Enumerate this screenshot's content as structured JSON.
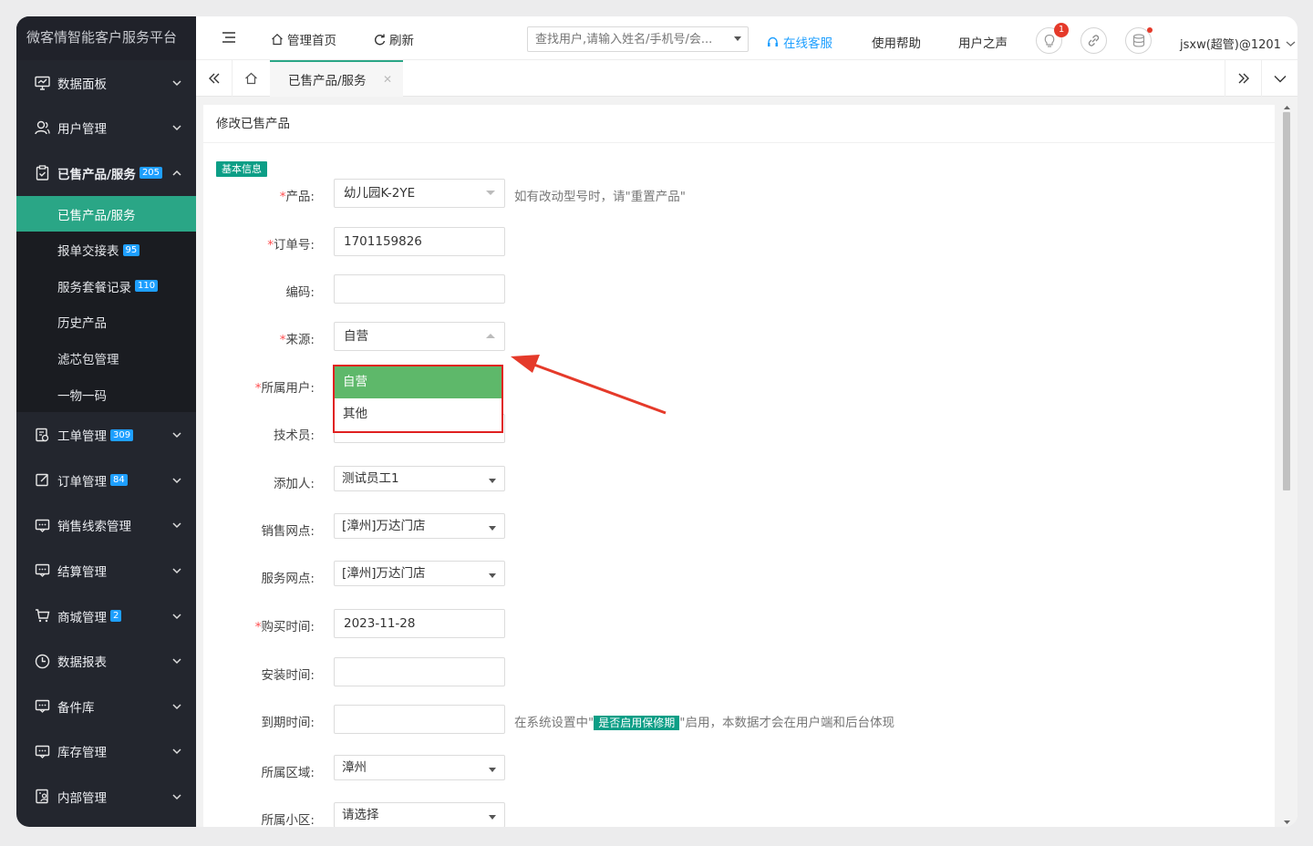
{
  "app": {
    "title": "微客情智能客户服务平台"
  },
  "sidebar": {
    "items": [
      {
        "label": "数据面板",
        "icon": "dashboard-icon"
      },
      {
        "label": "用户管理",
        "icon": "user-icon"
      },
      {
        "label": "已售产品/服务",
        "icon": "clipboard-check-icon",
        "badge": "205"
      }
    ],
    "subitems": [
      {
        "label": "已售产品/服务"
      },
      {
        "label": "报单交接表",
        "badge": "95"
      },
      {
        "label": "服务套餐记录",
        "badge": "110"
      },
      {
        "label": "历史产品"
      },
      {
        "label": "滤芯包管理"
      },
      {
        "label": "一物一码"
      }
    ],
    "items2": [
      {
        "label": "工单管理",
        "badge": "309",
        "icon": "workorder-icon"
      },
      {
        "label": "订单管理",
        "badge": "84",
        "icon": "order-edit-icon"
      },
      {
        "label": "销售线索管理",
        "icon": "chat-icon"
      },
      {
        "label": "结算管理",
        "icon": "chat-icon"
      },
      {
        "label": "商城管理",
        "badge": "2",
        "icon": "cart-icon"
      },
      {
        "label": "数据报表",
        "icon": "clock-icon"
      },
      {
        "label": "备件库",
        "icon": "chat-icon"
      },
      {
        "label": "库存管理",
        "icon": "chat-icon"
      },
      {
        "label": "内部管理",
        "icon": "internal-icon"
      }
    ]
  },
  "header": {
    "menu_icon": "menu-icon",
    "home_label": "管理首页",
    "refresh_label": "刷新",
    "search_placeholder": "查找用户,请输入姓名/手机号/会...",
    "online_service": "在线客服",
    "help": "使用帮助",
    "voice": "用户之声",
    "notify_count": "1",
    "account": "jsxw(超管)@1201"
  },
  "tabs": {
    "active": "已售产品/服务"
  },
  "form": {
    "title": "修改已售产品",
    "section": "基本信息",
    "fields": {
      "product": {
        "label": "产品:",
        "value": "幼儿园K-2YE",
        "hint": "如有改动型号时，请\"重置产品\""
      },
      "order_no": {
        "label": "订单号:",
        "value": "1701159826"
      },
      "code": {
        "label": "编码:",
        "value": ""
      },
      "source": {
        "label": "来源:",
        "value": "自营",
        "options": [
          "自营",
          "其他"
        ]
      },
      "owner": {
        "label": "所属用户:"
      },
      "technician": {
        "label": "技术员:"
      },
      "adder": {
        "label": "添加人:",
        "value": "测试员工1"
      },
      "sales_point": {
        "label": "销售网点:",
        "value": "[漳州]万达门店"
      },
      "service_point": {
        "label": "服务网点:",
        "value": "[漳州]万达门店"
      },
      "purchase_time": {
        "label": "购买时间:",
        "value": "2023-11-28"
      },
      "install_time": {
        "label": "安装时间:",
        "value": ""
      },
      "expire_time": {
        "label": "到期时间:",
        "value": "",
        "hint_pre": "在系统设置中\"",
        "hint_tag": "是否启用保修期",
        "hint_post": "\"启用，本数据才会在用户端和后台体现"
      },
      "region": {
        "label": "所属区域:",
        "value": "漳州"
      },
      "community": {
        "label": "所属小区:",
        "value": "请选择"
      }
    }
  },
  "colors": {
    "accent": "#2aa686",
    "sidebar_bg": "#23262e",
    "badge": "#1e9fff",
    "highlight": "#e02020"
  }
}
